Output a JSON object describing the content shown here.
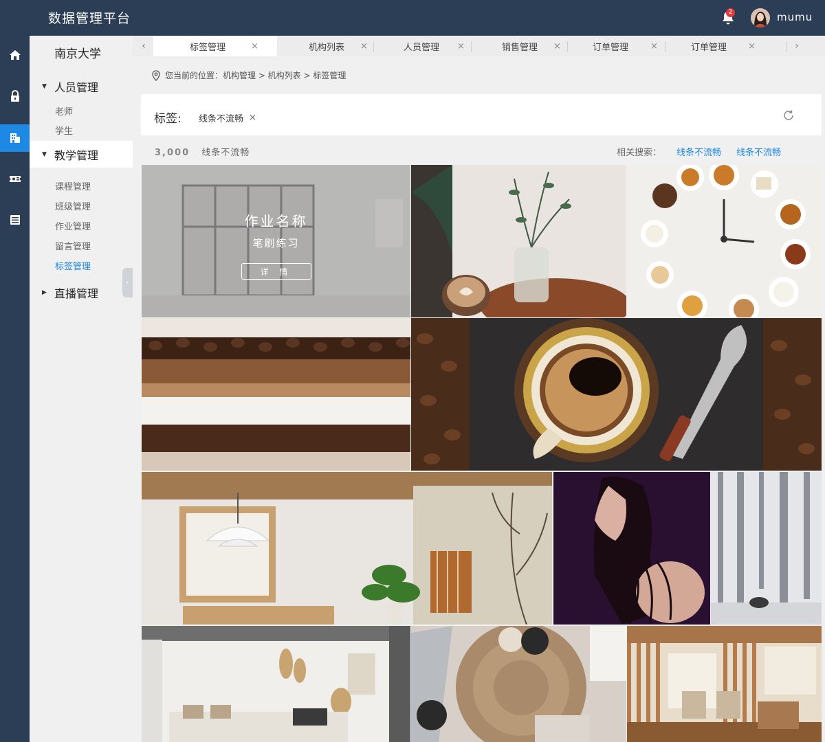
{
  "app": {
    "title": "数据管理平台",
    "username": "mumu",
    "notification_count": "2"
  },
  "rail": {
    "items": [
      {
        "icon": "home-icon"
      },
      {
        "icon": "lock-icon"
      },
      {
        "icon": "building-icon",
        "active": true
      },
      {
        "icon": "ticket-icon"
      },
      {
        "icon": "list-icon"
      }
    ]
  },
  "sidebar": {
    "school": "南京大学",
    "groups": [
      {
        "label": "人员管理",
        "children": [
          "老师",
          "学生"
        ]
      },
      {
        "label": "教学管理",
        "children": [
          "课程管理",
          "班级管理",
          "作业管理",
          "留言管理",
          "标签管理"
        ],
        "active_child": "标签管理"
      },
      {
        "label": "直播管理",
        "children": []
      }
    ]
  },
  "tabs": [
    {
      "label": "标签管理",
      "active": true
    },
    {
      "label": "机构列表"
    },
    {
      "label": "人员管理"
    },
    {
      "label": "销售管理"
    },
    {
      "label": "订单管理"
    },
    {
      "label": "订单管理"
    }
  ],
  "breadcrumb": {
    "text": "您当前的位置：机构管理 > 机构列表 > 标签管理"
  },
  "tag_panel": {
    "title": "标签:",
    "chip": "线条不流畅",
    "close": "×"
  },
  "stats": {
    "count": "3,000",
    "tag": "线条不流畅",
    "related_label": "相关搜索：",
    "related": [
      "线条不流畅",
      "线条不流畅"
    ]
  },
  "overlay": {
    "title": "作业名称",
    "subtitle": "笔刷练习",
    "button": "详 情"
  },
  "colors": {
    "topbar": "#2c3e55",
    "accent": "#1e88e5"
  }
}
